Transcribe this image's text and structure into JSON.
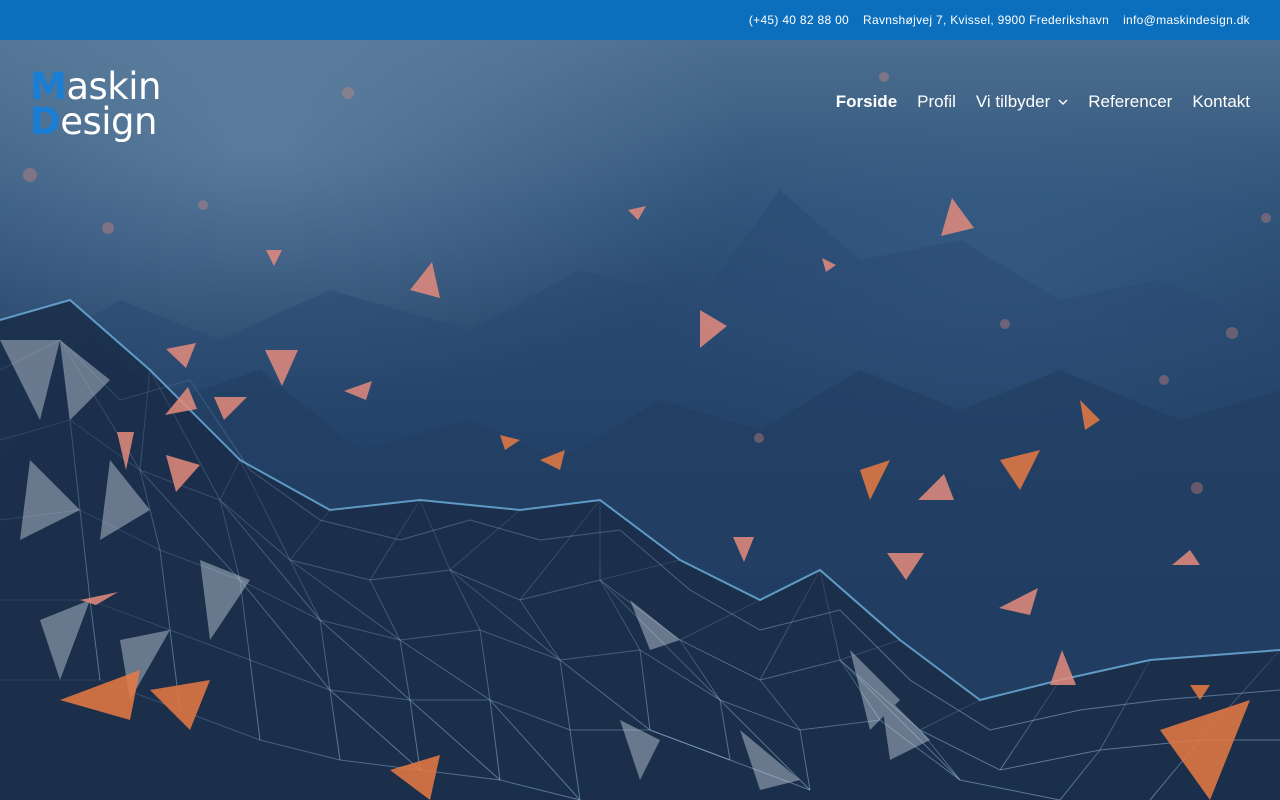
{
  "topbar": {
    "phone": "(+45) 40 82 88 00",
    "address": "Ravnshøjvej 7, Kvissel, 9900 Frederikshavn",
    "email": "info@maskindesign.dk"
  },
  "logo": {
    "line1_cap": "M",
    "line1_rest": "askin",
    "line2_cap": "D",
    "line2_rest": "esign"
  },
  "nav": {
    "items": [
      {
        "label": "Forside",
        "active": true
      },
      {
        "label": "Profil"
      },
      {
        "label": "Vi tilbyder",
        "has_dropdown": true
      },
      {
        "label": "Referencer"
      },
      {
        "label": "Kontakt"
      }
    ]
  },
  "colors": {
    "topbar_bg": "#0c6fbd",
    "logo_accent": "#1a7ed4",
    "text": "#ffffff"
  },
  "icons": {
    "dropdown": "chevron-down-icon"
  }
}
